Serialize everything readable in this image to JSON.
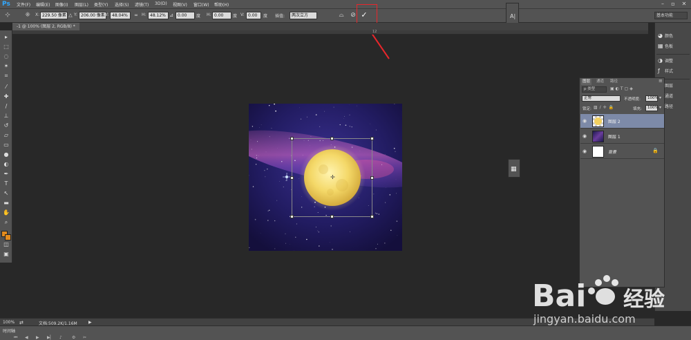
{
  "app": {
    "logo": "Ps"
  },
  "menubar": {
    "items": [
      "文件(F)",
      "编辑(E)",
      "图像(I)",
      "图层(L)",
      "类型(Y)",
      "选择(S)",
      "滤镜(T)",
      "3D(D)",
      "视图(V)",
      "窗口(W)",
      "帮助(H)"
    ]
  },
  "options": {
    "x_label": "X:",
    "x_value": "229.50 像素",
    "y_label": "Y:",
    "y_value": "206.00 像素",
    "w_label": "W:",
    "w_value": "48.04%",
    "h_label": "H:",
    "h_value": "48.12%",
    "angle_value": "0.00",
    "angle_unit": "度",
    "hskew_label": "H:",
    "hskew_value": "0.00",
    "hskew_unit": "度",
    "vskew_label": "V:",
    "vskew_value": "0.00",
    "vskew_unit": "度",
    "interp_label": "插值:",
    "interp_value": "两次立方",
    "workspace": "基本功能"
  },
  "document": {
    "tab_title": "-1 @ 100% (图层 2, RGB/8) *",
    "ruler_mark": "12"
  },
  "right_icons": {
    "color": "颜色",
    "swatches": "色板",
    "adjust": "调整",
    "styles": "样式",
    "layers": "图层",
    "channels": "通道",
    "paths": "路径"
  },
  "layers_panel": {
    "tabs": [
      "图层",
      "通道",
      "路径"
    ],
    "filter_kind": "p 类型",
    "blend_mode": "正常",
    "opacity_label": "不透明度:",
    "opacity_value": "100%",
    "lock_label": "锁定:",
    "fill_label": "填充:",
    "fill_value": "100%",
    "layers": [
      {
        "name": "图层 2",
        "selected": true
      },
      {
        "name": "图层 1",
        "selected": false
      },
      {
        "name": "背景",
        "selected": false
      }
    ]
  },
  "status": {
    "zoom": "100%",
    "doc_info": "文档:509.2K/1.16M",
    "timeline": "时间轴"
  },
  "watermark": {
    "brand": "Bai",
    "brand_cn": "经验",
    "url": "jingyan.baidu.com"
  },
  "colors": {
    "foreground": "#e38b1d",
    "background": "#e38b1d",
    "highlight": "#e8262b",
    "selected_layer": "#7d8aa8"
  }
}
